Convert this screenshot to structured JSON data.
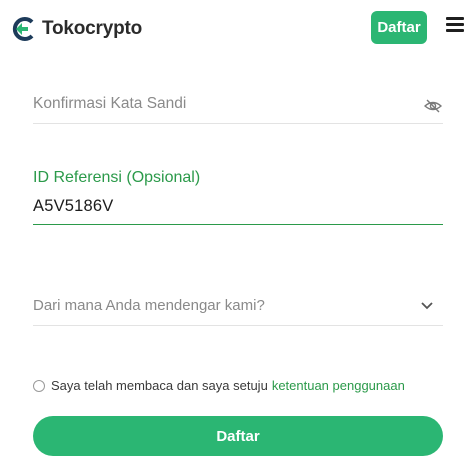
{
  "header": {
    "logo_text": "Tokocrypto",
    "signup_button": "Daftar"
  },
  "form": {
    "confirm_password": {
      "placeholder": "Konfirmasi Kata Sandi"
    },
    "referral": {
      "label": "ID Referensi (Opsional)",
      "value": "A5V5186V"
    },
    "source": {
      "placeholder": "Dari mana Anda mendengar kami?"
    },
    "terms": {
      "text": "Saya telah membaca dan saya setuju",
      "link": "ketentuan penggunaan"
    },
    "submit_label": "Daftar"
  },
  "colors": {
    "brand_green": "#2bb673",
    "label_green": "#2b9a4a"
  }
}
